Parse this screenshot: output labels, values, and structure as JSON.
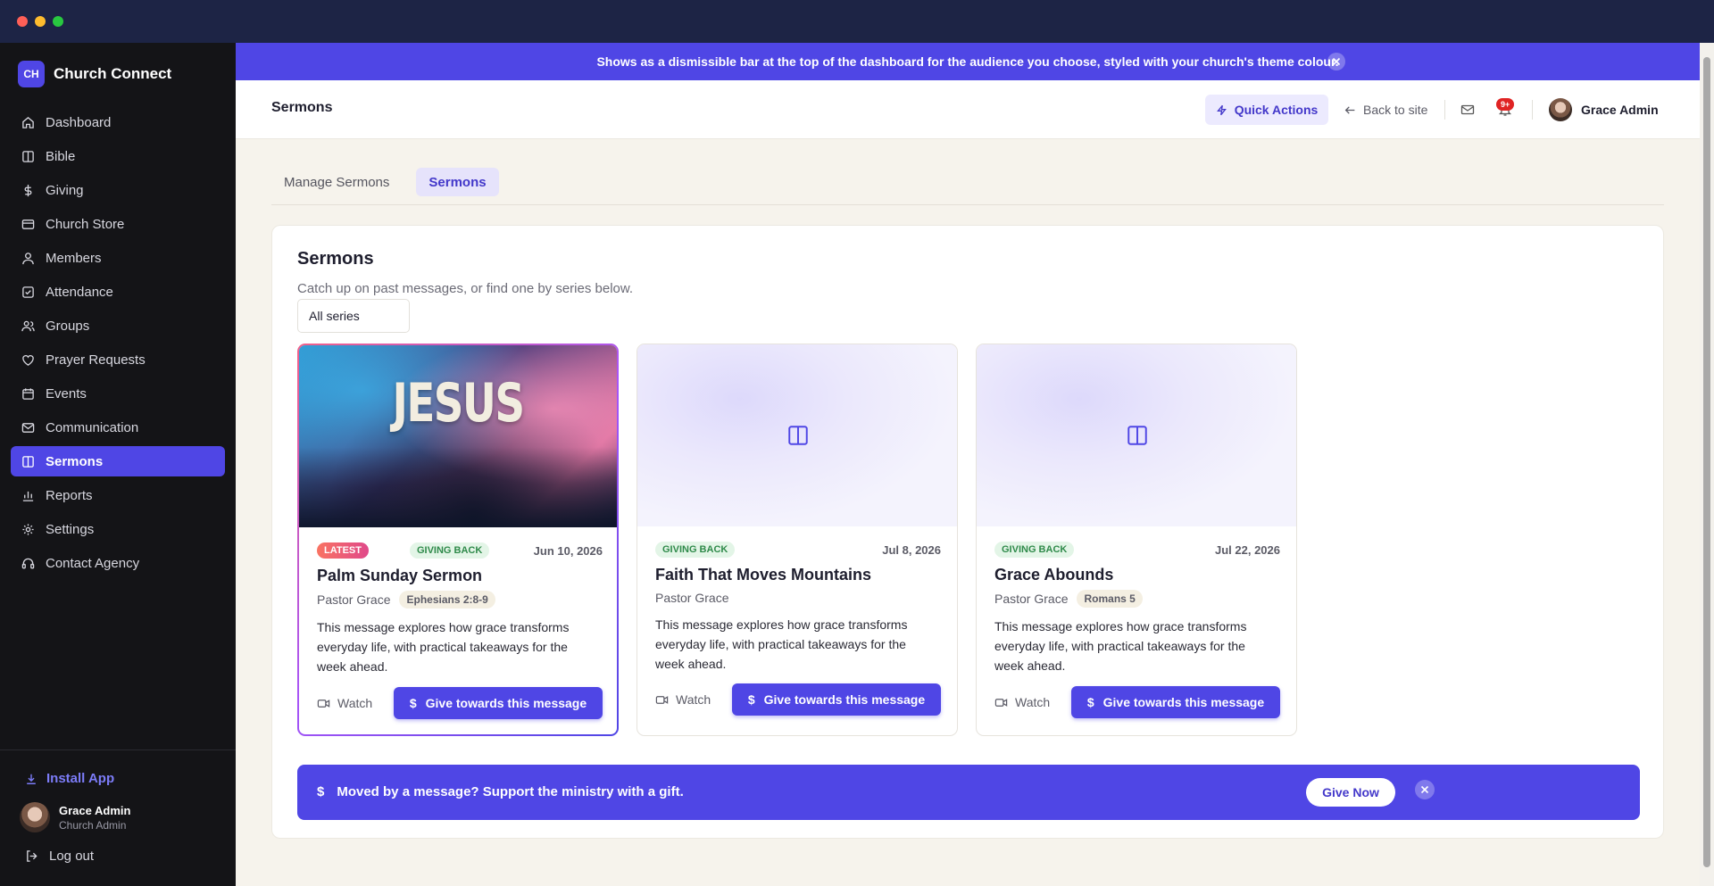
{
  "app": {
    "brand_initials": "CH",
    "brand_name": "Church Connect",
    "accent_color": "#4f46e5"
  },
  "sidebar": {
    "items": [
      {
        "label": "Dashboard",
        "icon": "home-icon"
      },
      {
        "label": "Bible",
        "icon": "book-icon"
      },
      {
        "label": "Giving",
        "icon": "dollar-icon"
      },
      {
        "label": "Church Store",
        "icon": "store-icon"
      },
      {
        "label": "Members",
        "icon": "user-icon"
      },
      {
        "label": "Attendance",
        "icon": "check-square-icon"
      },
      {
        "label": "Groups",
        "icon": "users-icon"
      },
      {
        "label": "Prayer Requests",
        "icon": "heart-icon"
      },
      {
        "label": "Events",
        "icon": "calendar-icon"
      },
      {
        "label": "Communication",
        "icon": "mail-icon"
      },
      {
        "label": "Sermons",
        "icon": "book-open-icon",
        "active": true
      },
      {
        "label": "Reports",
        "icon": "chart-icon"
      },
      {
        "label": "Settings",
        "icon": "gear-icon"
      },
      {
        "label": "Contact Agency",
        "icon": "headset-icon"
      }
    ],
    "install_label": "Install App",
    "user_name": "Grace Admin",
    "user_role": "Church Admin",
    "logout_label": "Log out"
  },
  "announcement": {
    "text": "Shows as a dismissible bar at the top of the dashboard for the audience you choose, styled with your church's theme colour."
  },
  "header": {
    "title": "Sermons",
    "quick_actions": "Quick Actions",
    "back_to_site": "Back to site",
    "notif_badge": "9+",
    "user_name": "Grace Admin"
  },
  "tabs": [
    {
      "label": "Manage Sermons",
      "active": false
    },
    {
      "label": "Sermons",
      "active": true
    }
  ],
  "panel": {
    "title": "Sermons",
    "subtitle": "Catch up on past messages, or find one by series below.",
    "series_filter": "All series"
  },
  "sermons": [
    {
      "latest": "LATEST",
      "tag": "GIVING BACK",
      "date": "Jun 10, 2026",
      "title": "Palm Sunday Sermon",
      "pastor": "Pastor Grace",
      "scripture": "Ephesians 2:8-9",
      "thumb_text": "JESUS",
      "description": "This message explores how grace transforms everyday life, with practical takeaways for the week ahead.",
      "watch": "Watch",
      "give": "Give towards this message"
    },
    {
      "tag": "GIVING BACK",
      "date": "Jul 8, 2026",
      "title": "Faith That Moves Mountains",
      "pastor": "Pastor Grace",
      "description": "This message explores how grace transforms everyday life, with practical takeaways for the week ahead.",
      "watch": "Watch",
      "give": "Give towards this message"
    },
    {
      "tag": "GIVING BACK",
      "date": "Jul 22, 2026",
      "title": "Grace Abounds",
      "pastor": "Pastor Grace",
      "scripture": "Romans 5",
      "description": "This message explores how grace transforms everyday life, with practical takeaways for the week ahead.",
      "watch": "Watch",
      "give": "Give towards this message"
    }
  ],
  "give_banner": {
    "text": "Moved by a message? Support the ministry with a gift.",
    "button": "Give Now"
  }
}
